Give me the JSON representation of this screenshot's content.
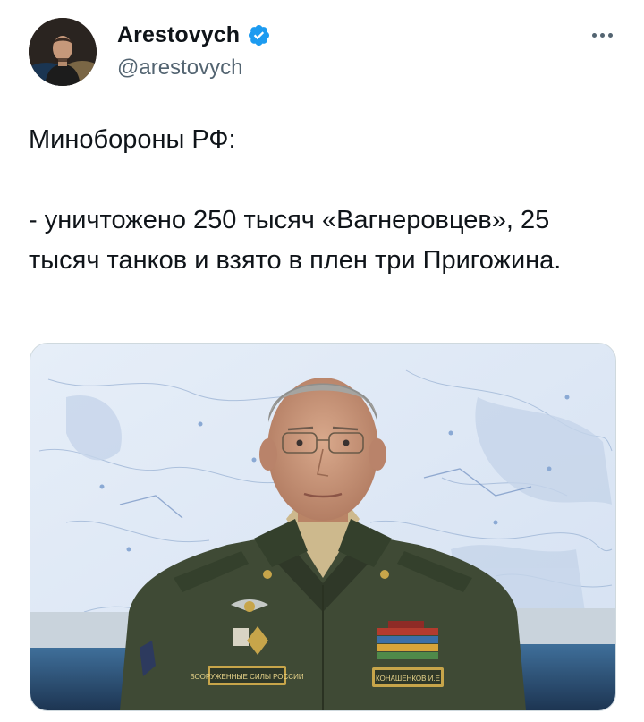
{
  "author": {
    "display_name": "Arestovych",
    "handle": "@arestovych",
    "verified": true,
    "verified_color": "#1d9bf0"
  },
  "menu": {
    "icon": "more-horizontal-icon"
  },
  "tweet": {
    "lines": [
      "Минобороны РФ:",
      "- уничтожено 250 тысяч «Вагнеровцев», 25 тысяч танков и взято в плен три Пригожина."
    ]
  },
  "media": {
    "badge_left": "ВООРУЖЕННЫЕ СИЛЫ РОССИИ",
    "badge_right": "КОНАШЕНКОВ И.Е"
  },
  "colors": {
    "text": "#0f1419",
    "secondary": "#536471",
    "border": "#cfd9de",
    "uniform": "#3f4a35",
    "map_bg": "#dfe8f5"
  }
}
